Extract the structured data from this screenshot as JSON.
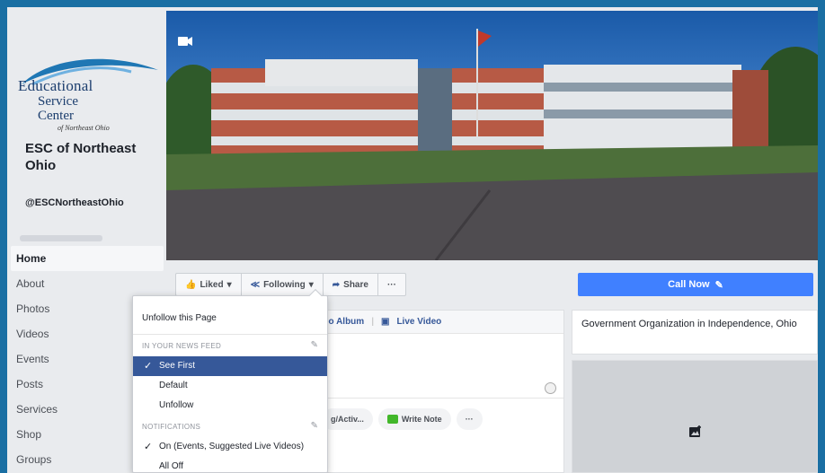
{
  "page": {
    "logo_lines": [
      "Educational",
      "Service",
      "Center",
      "of Northeast Ohio"
    ],
    "name": "ESC of Northeast Ohio",
    "handle": "@ESCNortheastOhio"
  },
  "sidebar": {
    "items": [
      {
        "label": "Home",
        "active": true
      },
      {
        "label": "About"
      },
      {
        "label": "Photos"
      },
      {
        "label": "Videos"
      },
      {
        "label": "Events"
      },
      {
        "label": "Posts"
      },
      {
        "label": "Services"
      },
      {
        "label": "Shop"
      },
      {
        "label": "Groups"
      }
    ]
  },
  "actions": {
    "liked": "Liked",
    "following": "Following",
    "share": "Share",
    "more": "···",
    "call": "Call Now"
  },
  "composer": {
    "tab_video_album": "eo Album",
    "tab_live_video": "Live Video",
    "pill_event": "g/Activ...",
    "pill_note": "Write Note",
    "pill_more": "···"
  },
  "info": {
    "category": "Government Organization in Independence, Ohio"
  },
  "dropdown": {
    "unfollow": "Unfollow this Page",
    "header_feed": "IN YOUR NEWS FEED",
    "see_first": "See First",
    "default": "Default",
    "unfollow_feed": "Unfollow",
    "header_notifications": "NOTIFICATIONS",
    "notif_on": "On (Events, Suggested Live Videos)",
    "notif_off": "All Off"
  },
  "colors": {
    "accent": "#4080ff",
    "selected": "#365899",
    "frame": "#1a6fa3"
  }
}
